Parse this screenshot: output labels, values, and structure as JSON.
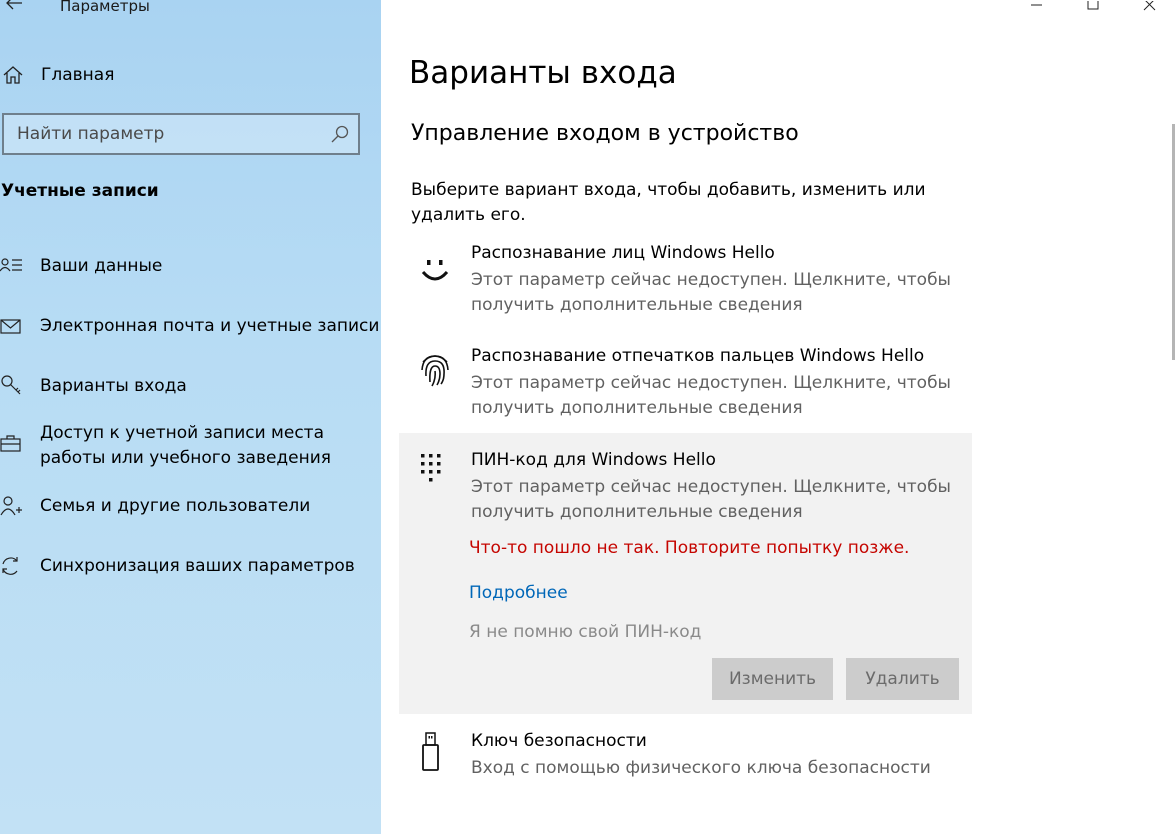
{
  "window": {
    "app_title": "Параметры",
    "controls": [
      "minimize-icon",
      "maximize-icon",
      "close-icon"
    ]
  },
  "sidebar": {
    "home_label": "Главная",
    "search": {
      "placeholder": "Найти параметр"
    },
    "section_title": "Учетные записи",
    "items": [
      {
        "icon": "person-list-icon",
        "label": "Ваши данные"
      },
      {
        "icon": "mail-icon",
        "label": "Электронная почта и учетные записи"
      },
      {
        "icon": "key-icon",
        "label": "Варианты входа"
      },
      {
        "icon": "briefcase-icon",
        "label": "Доступ к учетной записи места работы или учебного заведения"
      },
      {
        "icon": "person-add-icon",
        "label": "Семья и другие пользователи"
      },
      {
        "icon": "sync-icon",
        "label": "Синхронизация ваших параметров"
      }
    ]
  },
  "main": {
    "title": "Варианты входа",
    "subtitle": "Управление входом в устройство",
    "intro": "Выберите вариант входа, чтобы добавить, изменить или удалить его.",
    "options": [
      {
        "icon": "face-icon",
        "title": "Распознавание лиц Windows Hello",
        "desc": "Этот параметр сейчас недоступен. Щелкните, чтобы получить дополнительные сведения"
      },
      {
        "icon": "fingerprint-icon",
        "title": "Распознавание отпечатков пальцев Windows Hello",
        "desc": "Этот параметр сейчас недоступен. Щелкните, чтобы получить дополнительные сведения"
      },
      {
        "icon": "keypad-icon",
        "title": "ПИН-код для Windows Hello",
        "desc": "Этот параметр сейчас недоступен. Щелкните, чтобы получить дополнительные сведения"
      },
      {
        "icon": "usb-key-icon",
        "title": "Ключ безопасности",
        "desc": "Вход с помощью физического ключа безопасности"
      }
    ],
    "pin": {
      "error": "Что-то пошло не так. Повторите попытку позже.",
      "more_link": "Подробнее",
      "forgot": "Я не помню свой ПИН-код",
      "change_button": "Изменить",
      "remove_button": "Удалить"
    }
  },
  "colors": {
    "sidebar_top": "#a9d3f2",
    "error": "#c50500",
    "link": "#0067b8",
    "panel": "#f2f2f2"
  }
}
